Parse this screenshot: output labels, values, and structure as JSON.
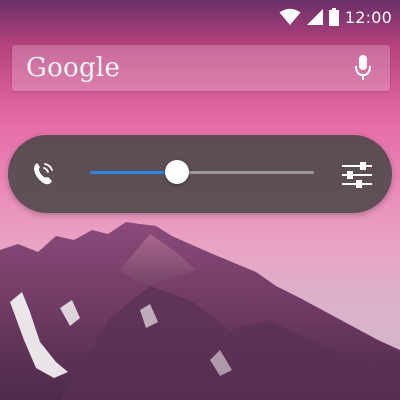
{
  "status_bar": {
    "time": "12:00",
    "icons": [
      "wifi-icon",
      "signal-icon",
      "battery-icon"
    ]
  },
  "search_bar": {
    "label": "Google",
    "mic_icon": "microphone-icon"
  },
  "volume_panel": {
    "left_icon": "phone-ringer-icon",
    "right_icon": "sliders-settings-icon",
    "level_fraction": 0.39
  },
  "colors": {
    "slider_fill": "#2b86e6",
    "slider_track": "#9a9a9a",
    "panel_bg": "#464646"
  }
}
